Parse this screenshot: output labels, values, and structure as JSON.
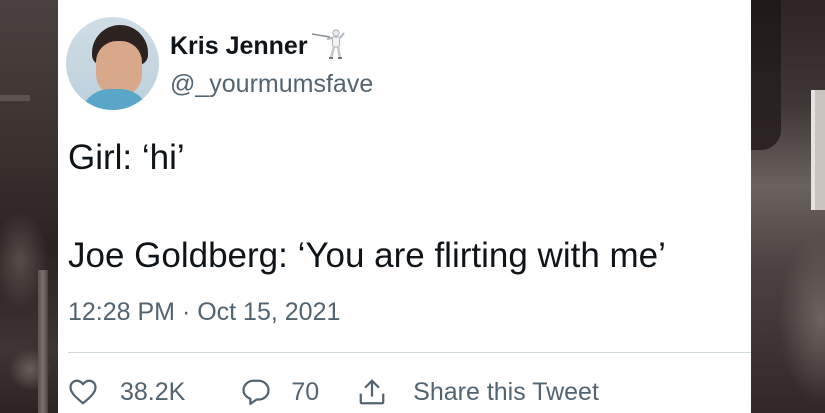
{
  "tweet": {
    "author": {
      "display_name": "Kris Jenner",
      "name_emoji": "fencer-icon",
      "handle": "@_yourmumsfave",
      "avatar": "profile-photo"
    },
    "lines": [
      "Girl: ‘hi’",
      "Joe Goldberg: ‘You are flirting with me’"
    ],
    "timestamp": "12:28 PM · Oct 15, 2021"
  },
  "actions": {
    "like_icon": "heart-icon",
    "like_count": "38.2K",
    "reply_icon": "speech-bubble-icon",
    "reply_count": "70",
    "share_icon": "share-arrow-icon",
    "share_label": "Share this Tweet"
  },
  "colors": {
    "text_primary": "#0f1419",
    "text_secondary": "#536471",
    "divider": "#cfd9de",
    "card_background": "#ffffff"
  }
}
